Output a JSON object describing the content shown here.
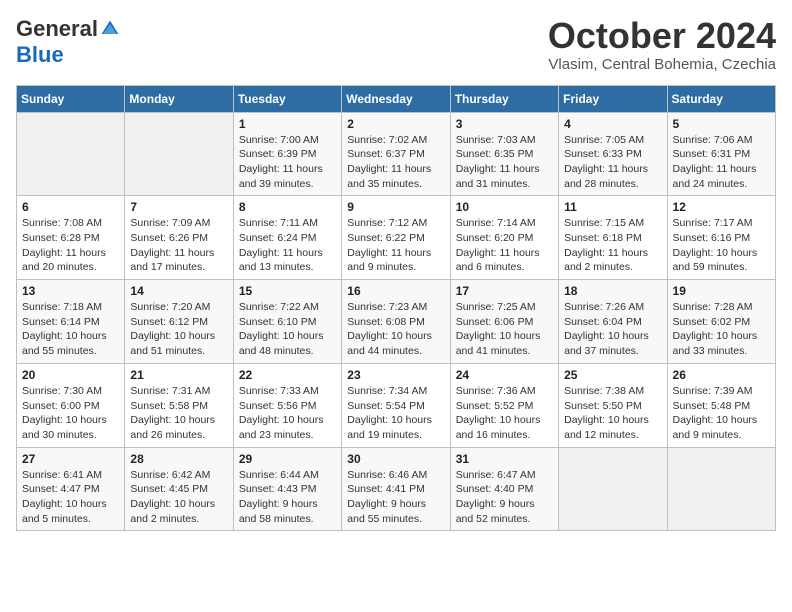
{
  "header": {
    "logo_general": "General",
    "logo_blue": "Blue",
    "month": "October 2024",
    "location": "Vlasim, Central Bohemia, Czechia"
  },
  "days_of_week": [
    "Sunday",
    "Monday",
    "Tuesday",
    "Wednesday",
    "Thursday",
    "Friday",
    "Saturday"
  ],
  "weeks": [
    [
      {
        "num": "",
        "detail": ""
      },
      {
        "num": "",
        "detail": ""
      },
      {
        "num": "1",
        "detail": "Sunrise: 7:00 AM\nSunset: 6:39 PM\nDaylight: 11 hours and 39 minutes."
      },
      {
        "num": "2",
        "detail": "Sunrise: 7:02 AM\nSunset: 6:37 PM\nDaylight: 11 hours and 35 minutes."
      },
      {
        "num": "3",
        "detail": "Sunrise: 7:03 AM\nSunset: 6:35 PM\nDaylight: 11 hours and 31 minutes."
      },
      {
        "num": "4",
        "detail": "Sunrise: 7:05 AM\nSunset: 6:33 PM\nDaylight: 11 hours and 28 minutes."
      },
      {
        "num": "5",
        "detail": "Sunrise: 7:06 AM\nSunset: 6:31 PM\nDaylight: 11 hours and 24 minutes."
      }
    ],
    [
      {
        "num": "6",
        "detail": "Sunrise: 7:08 AM\nSunset: 6:28 PM\nDaylight: 11 hours and 20 minutes."
      },
      {
        "num": "7",
        "detail": "Sunrise: 7:09 AM\nSunset: 6:26 PM\nDaylight: 11 hours and 17 minutes."
      },
      {
        "num": "8",
        "detail": "Sunrise: 7:11 AM\nSunset: 6:24 PM\nDaylight: 11 hours and 13 minutes."
      },
      {
        "num": "9",
        "detail": "Sunrise: 7:12 AM\nSunset: 6:22 PM\nDaylight: 11 hours and 9 minutes."
      },
      {
        "num": "10",
        "detail": "Sunrise: 7:14 AM\nSunset: 6:20 PM\nDaylight: 11 hours and 6 minutes."
      },
      {
        "num": "11",
        "detail": "Sunrise: 7:15 AM\nSunset: 6:18 PM\nDaylight: 11 hours and 2 minutes."
      },
      {
        "num": "12",
        "detail": "Sunrise: 7:17 AM\nSunset: 6:16 PM\nDaylight: 10 hours and 59 minutes."
      }
    ],
    [
      {
        "num": "13",
        "detail": "Sunrise: 7:18 AM\nSunset: 6:14 PM\nDaylight: 10 hours and 55 minutes."
      },
      {
        "num": "14",
        "detail": "Sunrise: 7:20 AM\nSunset: 6:12 PM\nDaylight: 10 hours and 51 minutes."
      },
      {
        "num": "15",
        "detail": "Sunrise: 7:22 AM\nSunset: 6:10 PM\nDaylight: 10 hours and 48 minutes."
      },
      {
        "num": "16",
        "detail": "Sunrise: 7:23 AM\nSunset: 6:08 PM\nDaylight: 10 hours and 44 minutes."
      },
      {
        "num": "17",
        "detail": "Sunrise: 7:25 AM\nSunset: 6:06 PM\nDaylight: 10 hours and 41 minutes."
      },
      {
        "num": "18",
        "detail": "Sunrise: 7:26 AM\nSunset: 6:04 PM\nDaylight: 10 hours and 37 minutes."
      },
      {
        "num": "19",
        "detail": "Sunrise: 7:28 AM\nSunset: 6:02 PM\nDaylight: 10 hours and 33 minutes."
      }
    ],
    [
      {
        "num": "20",
        "detail": "Sunrise: 7:30 AM\nSunset: 6:00 PM\nDaylight: 10 hours and 30 minutes."
      },
      {
        "num": "21",
        "detail": "Sunrise: 7:31 AM\nSunset: 5:58 PM\nDaylight: 10 hours and 26 minutes."
      },
      {
        "num": "22",
        "detail": "Sunrise: 7:33 AM\nSunset: 5:56 PM\nDaylight: 10 hours and 23 minutes."
      },
      {
        "num": "23",
        "detail": "Sunrise: 7:34 AM\nSunset: 5:54 PM\nDaylight: 10 hours and 19 minutes."
      },
      {
        "num": "24",
        "detail": "Sunrise: 7:36 AM\nSunset: 5:52 PM\nDaylight: 10 hours and 16 minutes."
      },
      {
        "num": "25",
        "detail": "Sunrise: 7:38 AM\nSunset: 5:50 PM\nDaylight: 10 hours and 12 minutes."
      },
      {
        "num": "26",
        "detail": "Sunrise: 7:39 AM\nSunset: 5:48 PM\nDaylight: 10 hours and 9 minutes."
      }
    ],
    [
      {
        "num": "27",
        "detail": "Sunrise: 6:41 AM\nSunset: 4:47 PM\nDaylight: 10 hours and 5 minutes."
      },
      {
        "num": "28",
        "detail": "Sunrise: 6:42 AM\nSunset: 4:45 PM\nDaylight: 10 hours and 2 minutes."
      },
      {
        "num": "29",
        "detail": "Sunrise: 6:44 AM\nSunset: 4:43 PM\nDaylight: 9 hours and 58 minutes."
      },
      {
        "num": "30",
        "detail": "Sunrise: 6:46 AM\nSunset: 4:41 PM\nDaylight: 9 hours and 55 minutes."
      },
      {
        "num": "31",
        "detail": "Sunrise: 6:47 AM\nSunset: 4:40 PM\nDaylight: 9 hours and 52 minutes."
      },
      {
        "num": "",
        "detail": ""
      },
      {
        "num": "",
        "detail": ""
      }
    ]
  ]
}
